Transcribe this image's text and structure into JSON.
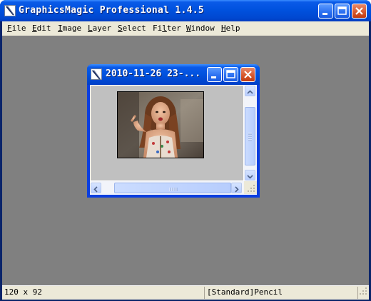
{
  "app": {
    "title": "GraphicsMagic Professional 1.4.5",
    "icon": "app-logo-icon"
  },
  "window_controls": {
    "minimize": "minimize-icon",
    "maximize": "maximize-icon",
    "close": "close-icon"
  },
  "menu": {
    "items": [
      {
        "key": "F",
        "rest": "ile"
      },
      {
        "key": "E",
        "rest": "dit"
      },
      {
        "key": "I",
        "rest": "mage"
      },
      {
        "key": "L",
        "rest": "ayer"
      },
      {
        "key": "S",
        "rest": "elect"
      },
      {
        "key": "F",
        "rest": "ilter",
        "prefix": "Fi",
        "suffix": "ter",
        "underline": "l"
      },
      {
        "key": "W",
        "rest": "indow"
      },
      {
        "key": "H",
        "rest": "elp"
      }
    ]
  },
  "child_window": {
    "title": "2010-11-26 23-...",
    "image_description_icon": "photo-thumbnail"
  },
  "status": {
    "image_size": "120 x 92",
    "tool": "[Standard]Pencil"
  },
  "colors": {
    "titlebar": "#0052de",
    "workspace": "#808080",
    "menubar": "#ece9d8",
    "close_button": "#d85a30"
  }
}
